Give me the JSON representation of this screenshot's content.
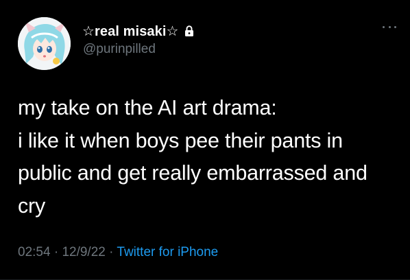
{
  "tweet": {
    "display_name": "☆real misaki☆",
    "handle": "@purinpilled",
    "text_lines": [
      "my take on the AI art drama:",
      "i like it when boys pee their pants in",
      "public and get really embarrassed and",
      "cry"
    ],
    "time": "02:54",
    "separator": " · ",
    "date": "12/9/22",
    "source": "Twitter for iPhone"
  },
  "icons": {
    "lock": "lock-icon",
    "more": "more-horizontal-icon"
  },
  "colors": {
    "background": "#000000",
    "text": "#ffffff",
    "secondary": "#6e767d",
    "link": "#1d9bf0"
  }
}
